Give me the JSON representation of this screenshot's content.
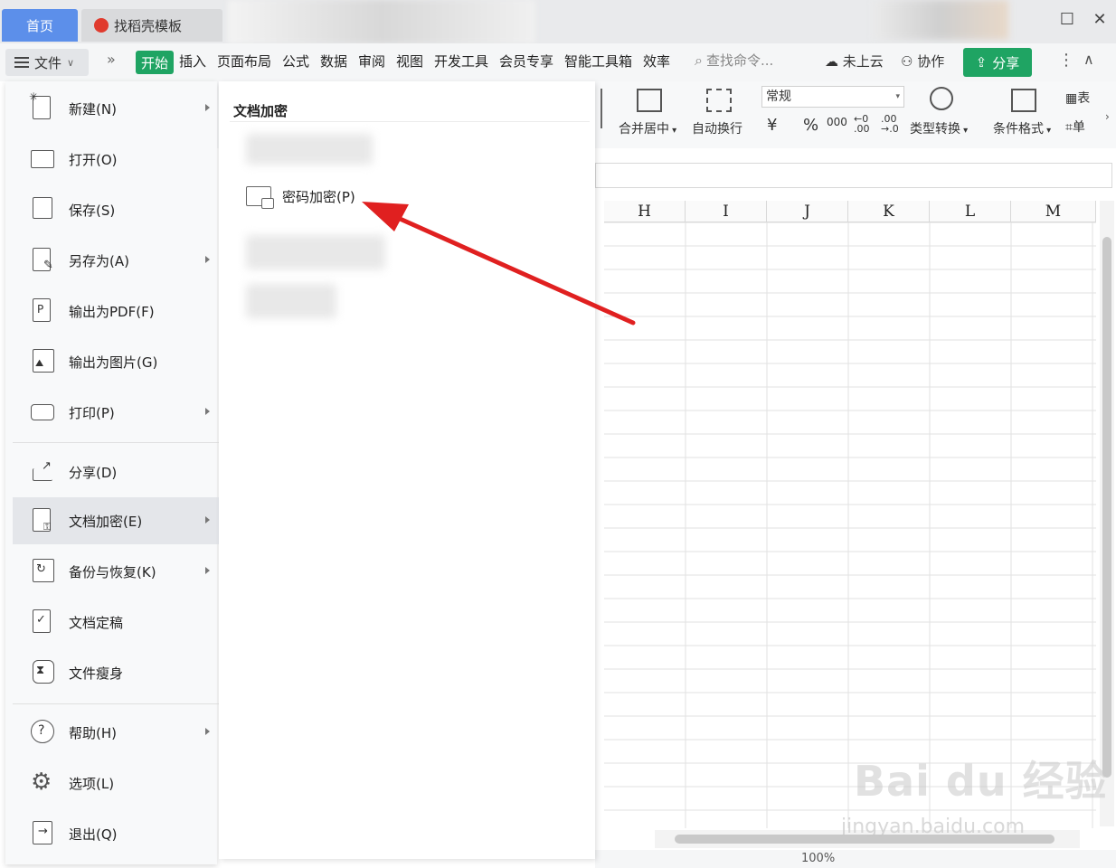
{
  "titlebar": {
    "tab_home": "首页",
    "tab_template": "找稻壳模板"
  },
  "menubar": {
    "file_label": "文件",
    "tabs": [
      "开始",
      "插入",
      "页面布局",
      "公式",
      "数据",
      "审阅",
      "视图",
      "开发工具",
      "会员专享",
      "智能工具箱",
      "效率"
    ],
    "search_placeholder": "查找命令...",
    "cloud_label": "未上云",
    "collab_label": "协作",
    "share_label": "分享"
  },
  "ribbon": {
    "merge_center": "合并居中",
    "auto_wrap": "自动换行",
    "number_format": "常规",
    "currency_symbol": "¥",
    "percent_symbol": "%",
    "thousands": "000",
    "dec_increase": "←0 .00",
    "dec_decrease": ".00 →.0",
    "type_convert": "类型转换",
    "cond_format": "条件格式",
    "table_label": "表",
    "cell_label": "单"
  },
  "sheet": {
    "columns": [
      "H",
      "I",
      "J",
      "K",
      "L",
      "M"
    ]
  },
  "file_menu": {
    "items": [
      {
        "label": "新建(N)",
        "icon": "new-file-icon",
        "arrow": true
      },
      {
        "label": "打开(O)",
        "icon": "open-folder-icon",
        "arrow": false
      },
      {
        "label": "保存(S)",
        "icon": "save-icon",
        "arrow": false
      },
      {
        "label": "另存为(A)",
        "icon": "save-as-icon",
        "arrow": true
      },
      {
        "label": "输出为PDF(F)",
        "icon": "pdf-export-icon",
        "arrow": false
      },
      {
        "label": "输出为图片(G)",
        "icon": "image-export-icon",
        "arrow": false
      },
      {
        "label": "打印(P)",
        "icon": "print-icon",
        "arrow": true
      },
      {
        "label": "分享(D)",
        "icon": "share-icon",
        "arrow": false
      },
      {
        "label": "文档加密(E)",
        "icon": "encrypt-doc-icon",
        "arrow": true,
        "active": true
      },
      {
        "label": "备份与恢复(K)",
        "icon": "backup-icon",
        "arrow": true
      },
      {
        "label": "文档定稿",
        "icon": "finalize-icon",
        "arrow": false
      },
      {
        "label": "文件瘦身",
        "icon": "slim-file-icon",
        "arrow": false
      },
      {
        "label": "帮助(H)",
        "icon": "help-icon",
        "arrow": true
      },
      {
        "label": "选项(L)",
        "icon": "settings-gear-icon",
        "arrow": false
      },
      {
        "label": "退出(Q)",
        "icon": "exit-icon",
        "arrow": false
      }
    ]
  },
  "submenu": {
    "title": "文档加密",
    "password_encrypt": "密码加密(P)"
  },
  "statusbar": {
    "zoom": "100%"
  },
  "watermark": {
    "main": "Bai du 经验",
    "url": "jingyan.baidu.com"
  },
  "colors": {
    "accent_green": "#1fa463",
    "home_tab_blue": "#5c8fea",
    "arrow_red": "#e02020"
  }
}
